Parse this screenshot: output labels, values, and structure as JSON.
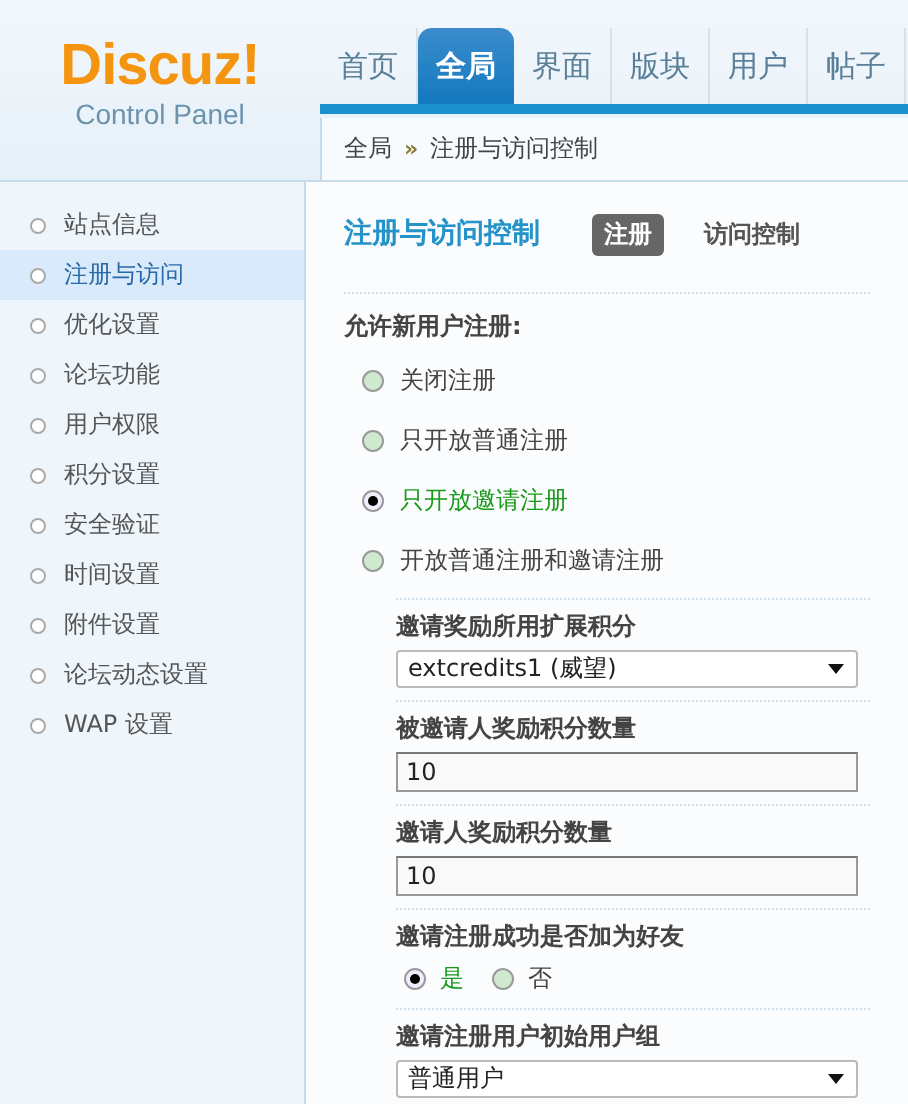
{
  "logo": {
    "title": "Discuz!",
    "subtitle": "Control Panel"
  },
  "nav": [
    {
      "label": "首页",
      "selected": false
    },
    {
      "label": "全局",
      "selected": true
    },
    {
      "label": "界面",
      "selected": false
    },
    {
      "label": "版块",
      "selected": false
    },
    {
      "label": "用户",
      "selected": false
    },
    {
      "label": "帖子",
      "selected": false
    }
  ],
  "breadcrumb": {
    "items": [
      "全局",
      "注册与访问控制"
    ],
    "separator": "»"
  },
  "sidebar": {
    "items": [
      {
        "label": "站点信息",
        "selected": false
      },
      {
        "label": "注册与访问",
        "selected": true
      },
      {
        "label": "优化设置",
        "selected": false
      },
      {
        "label": "论坛功能",
        "selected": false
      },
      {
        "label": "用户权限",
        "selected": false
      },
      {
        "label": "积分设置",
        "selected": false
      },
      {
        "label": "安全验证",
        "selected": false
      },
      {
        "label": "时间设置",
        "selected": false
      },
      {
        "label": "附件设置",
        "selected": false
      },
      {
        "label": "论坛动态设置",
        "selected": false
      },
      {
        "label": "WAP 设置",
        "selected": false
      }
    ]
  },
  "main": {
    "title": "注册与访问控制",
    "subtabs": [
      {
        "label": "注册",
        "selected": true
      },
      {
        "label": "访问控制",
        "selected": false
      }
    ],
    "section_label": "允许新用户注册:",
    "options": [
      {
        "label": "关闭注册",
        "selected": false
      },
      {
        "label": "只开放普通注册",
        "selected": false
      },
      {
        "label": "只开放邀请注册",
        "selected": true
      },
      {
        "label": "开放普通注册和邀请注册",
        "selected": false
      }
    ],
    "settings": [
      {
        "kind": "select",
        "label": "邀请奖励所用扩展积分",
        "value": "extcredits1 (威望)"
      },
      {
        "kind": "input",
        "label": "被邀请人奖励积分数量",
        "value": "10"
      },
      {
        "kind": "input",
        "label": "邀请人奖励积分数量",
        "value": "10"
      },
      {
        "kind": "radio",
        "label": "邀请注册成功是否加为好友",
        "options": [
          {
            "label": "是",
            "selected": true
          },
          {
            "label": "否",
            "selected": false
          }
        ]
      },
      {
        "kind": "select",
        "label": "邀请注册用户初始用户组",
        "value": "普通用户"
      }
    ]
  }
}
